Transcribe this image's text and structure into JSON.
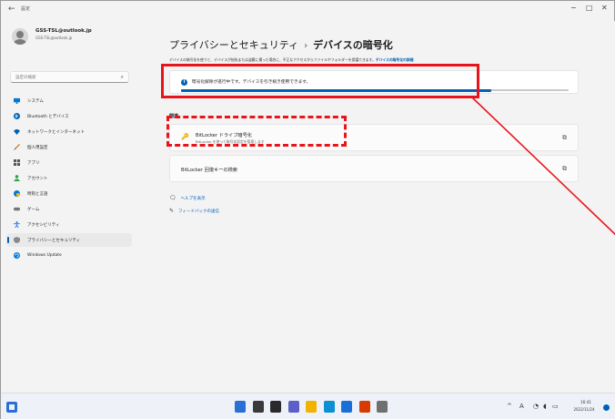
{
  "window": {
    "back_glyph": "←",
    "title": "設定",
    "controls": {
      "minimize": "−",
      "maximize": "□",
      "close": "✕"
    }
  },
  "account": {
    "name": "GSS-TSL@outlook.jp",
    "email": "GSS-TSL@outlook.jp"
  },
  "search": {
    "placeholder": "設定の検索",
    "icon": "search-icon"
  },
  "sidebar": {
    "items": [
      {
        "label": "システム",
        "icon": "monitor-icon",
        "color": "#0078d4"
      },
      {
        "label": "Bluetooth とデバイス",
        "icon": "bluetooth-icon",
        "color": "#0067c0"
      },
      {
        "label": "ネットワークとインターネット",
        "icon": "wifi-icon",
        "color": "#0063b1"
      },
      {
        "label": "個人用設定",
        "icon": "brush-icon",
        "color": "#c27c0e"
      },
      {
        "label": "アプリ",
        "icon": "apps-icon",
        "color": "#555555"
      },
      {
        "label": "アカウント",
        "icon": "person-icon",
        "color": "#2aa14a"
      },
      {
        "label": "時刻と言語",
        "icon": "globe-clock-icon",
        "color": "#0078d4"
      },
      {
        "label": "ゲーム",
        "icon": "gamepad-icon",
        "color": "#767676"
      },
      {
        "label": "アクセシビリティ",
        "icon": "accessibility-icon",
        "color": "#1a73e8"
      },
      {
        "label": "プライバシーとセキュリティ",
        "icon": "shield-icon",
        "color": "#8a8a8a",
        "selected": true
      },
      {
        "label": "Windows Update",
        "icon": "windows-update-icon",
        "color": "#0078d4"
      }
    ]
  },
  "main": {
    "breadcrumb_parent": "プライバシーとセキュリティ",
    "breadcrumb_sep": "›",
    "breadcrumb_current": "デバイスの暗号化",
    "description": "デバイスの暗号化を使うと、デバイスが紛失または盗難に遭った場合に、不正なアクセスからファイルやフォルダーを保護できます。",
    "description_link": "デバイスの暗号化の詳細",
    "status": {
      "icon_glyph": "i",
      "text": "暗号化解除が進行中です。デバイスを引き続き使用できます。",
      "progress": 0.8
    },
    "related_heading": "関連",
    "cards": [
      {
        "title": "BitLocker ドライブ暗号化",
        "subtitle": "BitLocker を使って暗号化設定を管理します",
        "icon": "bitlocker-icon",
        "icon_glyph": "🔑",
        "ext_glyph": "⧉"
      },
      {
        "title": "BitLocker 回復キーの検索",
        "subtitle": "",
        "icon": "",
        "icon_glyph": "",
        "ext_glyph": "⧉"
      }
    ],
    "links": [
      {
        "label": "ヘルプを表示",
        "icon": "help-icon",
        "glyph": "🗨"
      },
      {
        "label": "フィードバックの送信",
        "icon": "feedback-icon",
        "glyph": "✎"
      }
    ]
  },
  "taskbar": {
    "apps": [
      {
        "name": "widgets",
        "color": "#2b6fd6"
      },
      {
        "name": "search",
        "color": "#3a3a3a"
      },
      {
        "name": "task-view",
        "color": "#2a2a2a"
      },
      {
        "name": "teams",
        "color": "#5b5fc7"
      },
      {
        "name": "file-explorer",
        "color": "#f2b300"
      },
      {
        "name": "edge",
        "color": "#0c8fd3"
      },
      {
        "name": "store",
        "color": "#1a6fd6"
      },
      {
        "name": "office",
        "color": "#d83b01"
      },
      {
        "name": "settings",
        "color": "#707070"
      }
    ],
    "tray": {
      "chevron": "^",
      "ime": "A",
      "wifi": "wifi-icon",
      "volume": "volume-icon",
      "battery": "battery-icon"
    },
    "time": "16:41",
    "date": "2022/11/24"
  },
  "annotation_color": "#e8141b"
}
